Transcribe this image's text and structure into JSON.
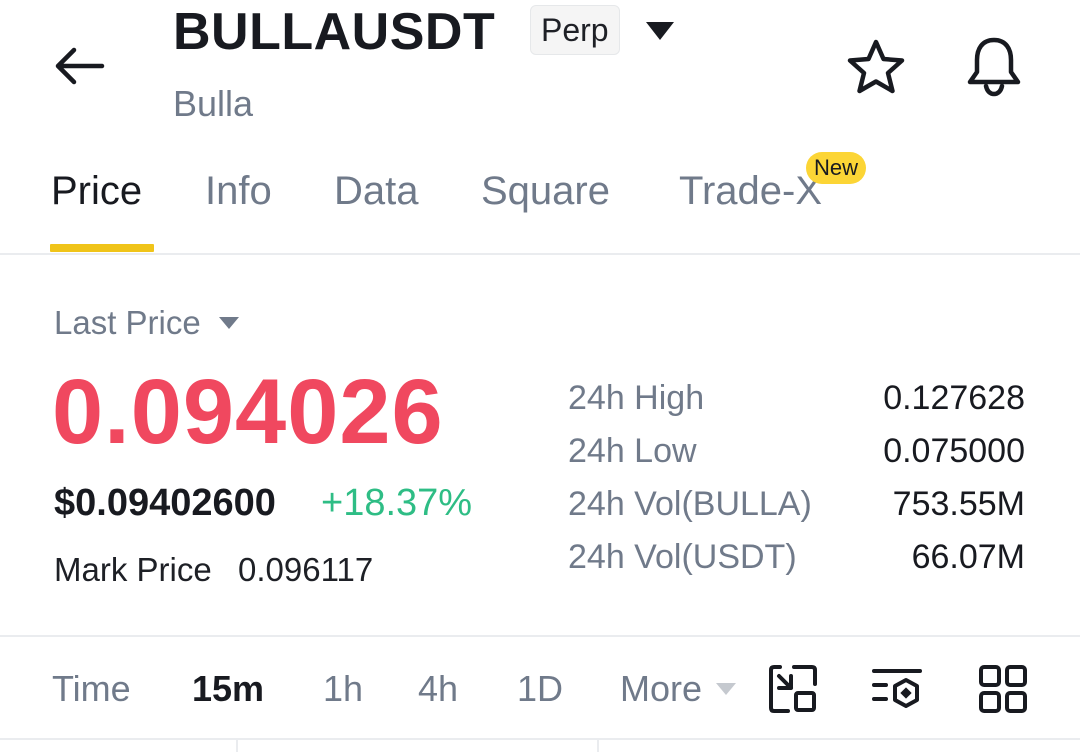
{
  "header": {
    "symbol": "BULLAUSDT",
    "contract_type": "Perp",
    "base_name": "Bulla",
    "icons": {
      "back": "back-arrow-icon",
      "dropdown": "caret-down-icon",
      "favorite": "star-icon",
      "alerts": "bell-icon"
    }
  },
  "tabs": [
    {
      "label": "Price",
      "active": true
    },
    {
      "label": "Info",
      "active": false
    },
    {
      "label": "Data",
      "active": false
    },
    {
      "label": "Square",
      "active": false
    },
    {
      "label": "Trade-X",
      "active": false,
      "badge": "New"
    }
  ],
  "accent_color": "#f0c419",
  "price": {
    "selector_label": "Last Price",
    "last_price": "0.094026",
    "usd_value": "$0.09402600",
    "change_pct": "+18.37%",
    "mark_label": "Mark Price",
    "mark_value": "0.096117",
    "colors": {
      "down": "#f0485f",
      "up": "#2ebd85"
    }
  },
  "stats": [
    {
      "label": "24h High",
      "value": "0.127628"
    },
    {
      "label": "24h Low",
      "value": "0.075000"
    },
    {
      "label": "24h Vol(BULLA)",
      "value": "753.55M"
    },
    {
      "label": "24h Vol(USDT)",
      "value": "66.07M"
    }
  ],
  "intervals": {
    "items": [
      {
        "label": "Time",
        "active": false
      },
      {
        "label": "15m",
        "active": true
      },
      {
        "label": "1h",
        "active": false
      },
      {
        "label": "4h",
        "active": false
      },
      {
        "label": "1D",
        "active": false
      }
    ],
    "more_label": "More",
    "tool_icons": [
      "fullscreen-icon",
      "indicator-settings-icon",
      "grid-layout-icon"
    ]
  }
}
